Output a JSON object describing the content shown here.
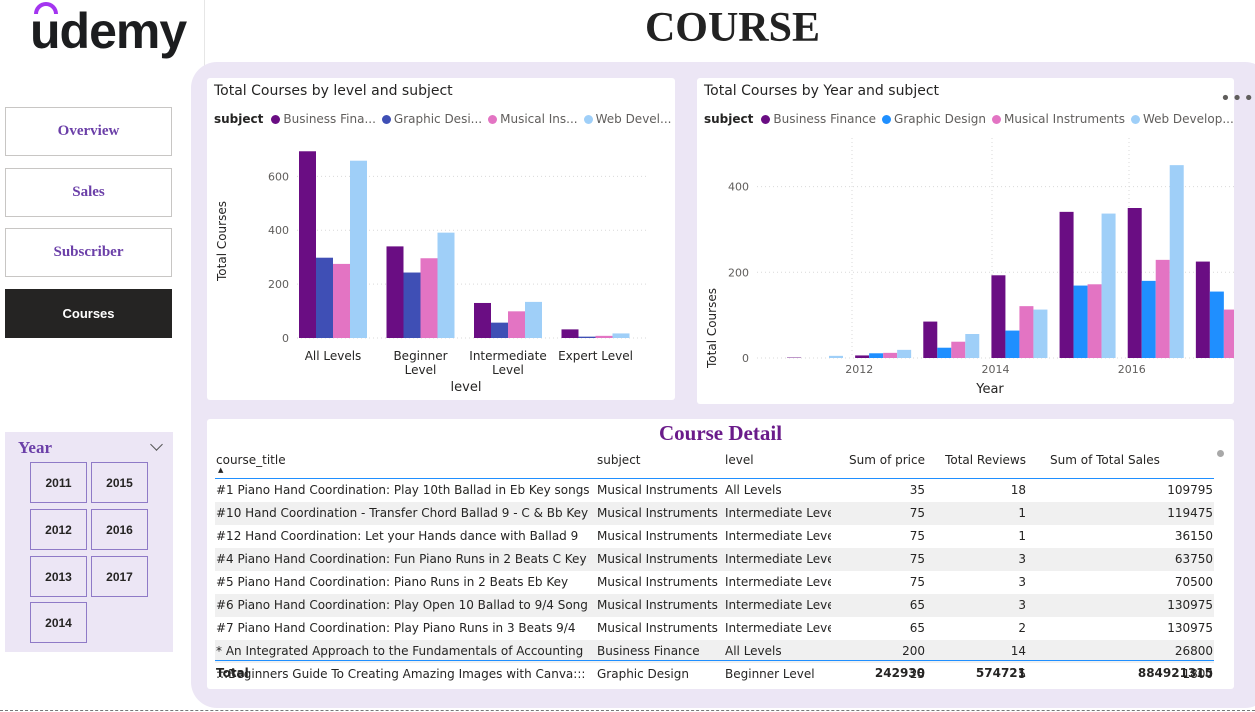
{
  "brand": {
    "logo_text": "udemy",
    "accent": "#a435f0"
  },
  "page": {
    "title": "COURSE"
  },
  "nav": [
    {
      "label": "Overview",
      "active": false
    },
    {
      "label": "Sales",
      "active": false
    },
    {
      "label": "Subscriber",
      "active": false
    },
    {
      "label": "Courses",
      "active": true
    }
  ],
  "year_slicer": {
    "title": "Year",
    "years": [
      "2011",
      "2015",
      "2012",
      "2016",
      "2013",
      "2017",
      "2014"
    ]
  },
  "more_icon": "more-options-icon",
  "legend_label": "subject",
  "colors": {
    "business_finance": "#6a0d83",
    "graphic_design_level": "#3f4fb5",
    "graphic_design_year": "#1f8fff",
    "musical_instruments": "#e374c3",
    "web_development": "#9fcff8",
    "panel_bg": "#ece6f5"
  },
  "chart_data": [
    {
      "type": "bar",
      "title": "Total Courses by level and subject",
      "legend_entries": [
        "Business Fina...",
        "Graphic Desi...",
        "Musical Ins...",
        "Web Devel..."
      ],
      "xlabel": "level",
      "ylabel": "Total Courses",
      "categories": [
        "All Levels",
        "Beginner Level",
        "Intermediate Level",
        "Expert Level"
      ],
      "category_lines": [
        [
          "All Levels"
        ],
        [
          "Beginner",
          "Level"
        ],
        [
          "Intermediate",
          "Level"
        ],
        [
          "Expert Level"
        ]
      ],
      "series": [
        {
          "name": "Business Finance",
          "values": [
            693,
            340,
            130,
            32
          ]
        },
        {
          "name": "Graphic Design",
          "values": [
            298,
            243,
            57,
            5
          ]
        },
        {
          "name": "Musical Instruments",
          "values": [
            275,
            296,
            99,
            8
          ]
        },
        {
          "name": "Web Development",
          "values": [
            658,
            391,
            134,
            17
          ]
        }
      ],
      "yticks": [
        0,
        200,
        400,
        600
      ],
      "ylim": [
        0,
        720
      ],
      "grid": true,
      "legend_position": "top-left"
    },
    {
      "type": "bar",
      "title": "Total Courses by Year and subject",
      "legend_entries": [
        "Business Finance",
        "Graphic Design",
        "Musical Instruments",
        "Web Develop..."
      ],
      "xlabel": "Year",
      "ylabel": "Total Courses",
      "categories": [
        "2011",
        "2012",
        "2013",
        "2014",
        "2015",
        "2016",
        "2017"
      ],
      "xtick_labels": [
        "2012",
        "2014",
        "2016"
      ],
      "series": [
        {
          "name": "Business Finance",
          "values": [
            1,
            6,
            85,
            193,
            341,
            350,
            225
          ]
        },
        {
          "name": "Graphic Design",
          "values": [
            0,
            11,
            24,
            64,
            169,
            180,
            155
          ]
        },
        {
          "name": "Musical Instruments",
          "values": [
            0,
            12,
            38,
            121,
            172,
            229,
            113
          ]
        },
        {
          "name": "Web Development",
          "values": [
            5,
            19,
            56,
            113,
            337,
            450,
            225
          ]
        }
      ],
      "yticks": [
        0,
        200,
        400
      ],
      "ylim": [
        0,
        490
      ],
      "grid": true,
      "legend_position": "top-left"
    }
  ],
  "table": {
    "title": "Course Detail",
    "columns": [
      "course_title",
      "subject",
      "level",
      "Sum of price",
      "Total Reviews",
      "Sum of Total Sales"
    ],
    "rows": [
      [
        "#1 Piano Hand Coordination: Play 10th Ballad in Eb Key songs",
        "Musical Instruments",
        "All Levels",
        "35",
        "18",
        "109795"
      ],
      [
        "#10 Hand Coordination - Transfer Chord Ballad 9 - C & Bb Key",
        "Musical Instruments",
        "Intermediate Level",
        "75",
        "1",
        "119475"
      ],
      [
        "#12 Hand Coordination: Let your Hands dance with Ballad 9",
        "Musical Instruments",
        "Intermediate Level",
        "75",
        "1",
        "36150"
      ],
      [
        "#4 Piano Hand Coordination: Fun Piano Runs in 2 Beats C Key",
        "Musical Instruments",
        "Intermediate Level",
        "75",
        "3",
        "63750"
      ],
      [
        "#5 Piano Hand Coordination: Piano Runs in 2 Beats Eb Key",
        "Musical Instruments",
        "Intermediate Level",
        "75",
        "3",
        "70500"
      ],
      [
        "#6 Piano Hand Coordination: Play Open 10 Ballad to 9/4 Song",
        "Musical Instruments",
        "Intermediate Level",
        "65",
        "3",
        "130975"
      ],
      [
        "#7 Piano Hand Coordination: Play Piano Runs in 3 Beats 9/4",
        "Musical Instruments",
        "Intermediate Level",
        "65",
        "2",
        "130975"
      ],
      [
        "* An Integrated Approach to the Fundamentals of Accounting",
        "Business Finance",
        "All Levels",
        "200",
        "14",
        "26800"
      ],
      [
        ":::Beginners Guide To Creating Amazing Images with Canva:::",
        "Graphic Design",
        "Beginner Level",
        "25",
        "5",
        "1800"
      ]
    ],
    "total": {
      "label": "Total",
      "price": "242930",
      "reviews": "574721",
      "sales": "884921315"
    }
  }
}
